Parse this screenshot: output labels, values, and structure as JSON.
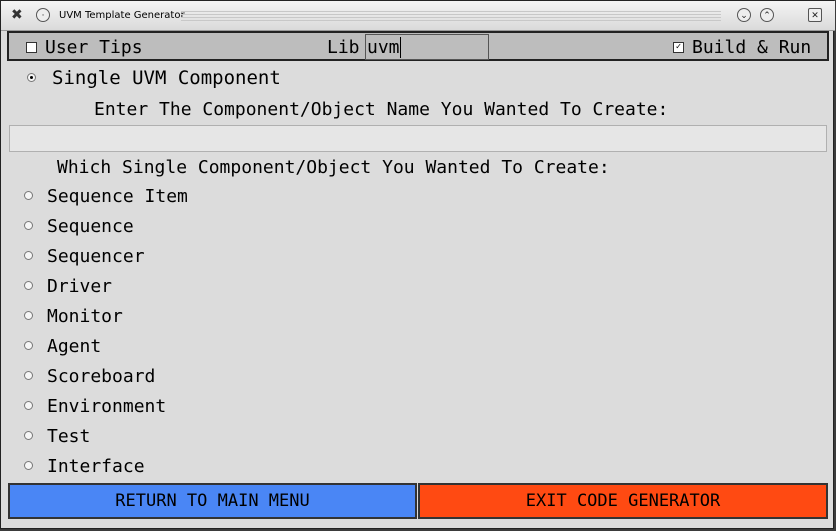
{
  "window": {
    "title": "UVM Template Generator",
    "app_icon": "tools-icon",
    "buttons": [
      "minimize",
      "maximize",
      "close"
    ]
  },
  "toolbar": {
    "user_tips": {
      "label": "User Tips",
      "checked": false
    },
    "lib_label": "Lib",
    "lib_value": "uvm",
    "build_run": {
      "label": "Build & Run",
      "checked": true
    }
  },
  "mode": {
    "label": "Single UVM Component",
    "selected": true
  },
  "name_prompt": "Enter The Component/Object Name You Wanted To Create:",
  "name_value": "",
  "choice_prompt": "Which Single Component/Object You Wanted To Create:",
  "options": [
    {
      "label": "Sequence Item"
    },
    {
      "label": "Sequence"
    },
    {
      "label": "Sequencer"
    },
    {
      "label": "Driver"
    },
    {
      "label": "Monitor"
    },
    {
      "label": "Agent"
    },
    {
      "label": "Scoreboard"
    },
    {
      "label": "Environment"
    },
    {
      "label": "Test"
    },
    {
      "label": "Interface"
    }
  ],
  "buttons": {
    "return_label": "RETURN TO MAIN MENU",
    "return_color": "#4a86f5",
    "exit_label": "EXIT CODE GENERATOR",
    "exit_color": "#ff4a12"
  }
}
